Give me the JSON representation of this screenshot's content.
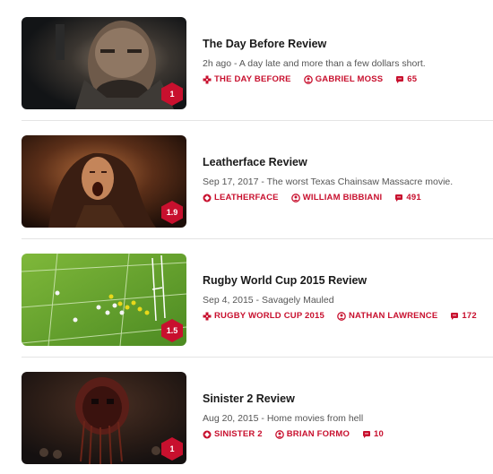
{
  "colors": {
    "accent": "#c8102e",
    "score_badge": "#c8102e",
    "divider": "#e4e4e4"
  },
  "reviews": [
    {
      "title": "The Day Before Review",
      "date": "2h ago",
      "separator": " - ",
      "subtitle": "A day late and more than a few dollars short.",
      "game": "THE DAY BEFORE",
      "game_icon": "gamepad-icon",
      "author": "GABRIEL MOSS",
      "comments": "65",
      "score": "1"
    },
    {
      "title": "Leatherface Review",
      "date": "Sep 17, 2017",
      "separator": " - ",
      "subtitle": "The worst Texas Chainsaw Massacre movie.",
      "game": "LEATHERFACE",
      "game_icon": "film-tag-icon",
      "author": "WILLIAM BIBBIANI",
      "comments": "491",
      "score": "1.9"
    },
    {
      "title": "Rugby World Cup 2015 Review",
      "date": "Sep 4, 2015",
      "separator": " - ",
      "subtitle": "Savagely Mauled",
      "game": "RUGBY WORLD CUP 2015",
      "game_icon": "gamepad-icon",
      "author": "NATHAN LAWRENCE",
      "comments": "172",
      "score": "1.5"
    },
    {
      "title": "Sinister 2 Review",
      "date": "Aug 20, 2015",
      "separator": " - ",
      "subtitle": "Home movies from hell",
      "game": "SINISTER 2",
      "game_icon": "film-tag-icon",
      "author": "BRIAN FORMO",
      "comments": "10",
      "score": "1"
    }
  ]
}
